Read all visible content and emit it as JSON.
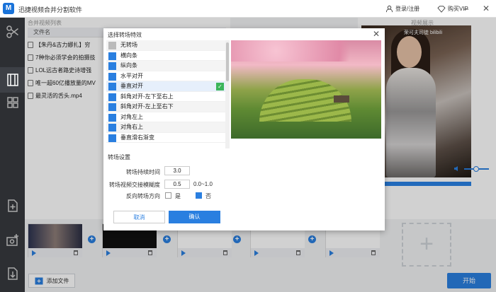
{
  "app": {
    "title": "迅捷视频合并分割软件",
    "logo_text": "M"
  },
  "titlebar": {
    "login": "登录/注册",
    "vip": "购买VIP"
  },
  "left_panel": {
    "label": "合并视频列表",
    "col_filename": "文件名"
  },
  "files": [
    "【朱丹&古力娜扎】穷",
    "7种你必须学会的拍摄技",
    "LOL远古者路史诗增强",
    "唯一超60亿播放量的MV",
    "最灵活的舌头.mp4"
  ],
  "right_panel": {
    "label": "视频展示",
    "watermark": "荣可夫司徒 bilibili"
  },
  "clip_thumb_text": "7 KNOTS YOU NEED TO KNOW",
  "add_file_button": "添加文件",
  "start_button": "开始",
  "dialog": {
    "title": "选择转场特效",
    "transitions": [
      {
        "label": "无转场",
        "icon": "none-icon"
      },
      {
        "label": "横向条",
        "icon": "transition-icon"
      },
      {
        "label": "纵向条",
        "icon": "transition-icon"
      },
      {
        "label": "水平对开",
        "icon": "transition-icon"
      },
      {
        "label": "垂直对开",
        "icon": "transition-icon",
        "selected": true
      },
      {
        "label": "斜角对开-左下至右上",
        "icon": "transition-icon"
      },
      {
        "label": "斜角对开-左上至右下",
        "icon": "transition-icon"
      },
      {
        "label": "对角左上",
        "icon": "transition-icon"
      },
      {
        "label": "对角右上",
        "icon": "transition-icon"
      },
      {
        "label": "垂直滑右渐变",
        "icon": "transition-icon"
      }
    ],
    "settings_title": "转场设置",
    "duration_label": "转场持续时间",
    "duration_value": "3.0",
    "blur_label": "转场视频交接模糊度",
    "blur_value": "0.5",
    "blur_range": "0.0~1.0",
    "reverse_label": "反向转场方向",
    "reverse_yes": "是",
    "reverse_no": "否",
    "reverse_selected": "否",
    "cancel": "取消",
    "ok": "确认"
  },
  "colors": {
    "accent": "#2a7fe0",
    "sidebar": "#2d2f33",
    "check": "#3cb55a"
  }
}
